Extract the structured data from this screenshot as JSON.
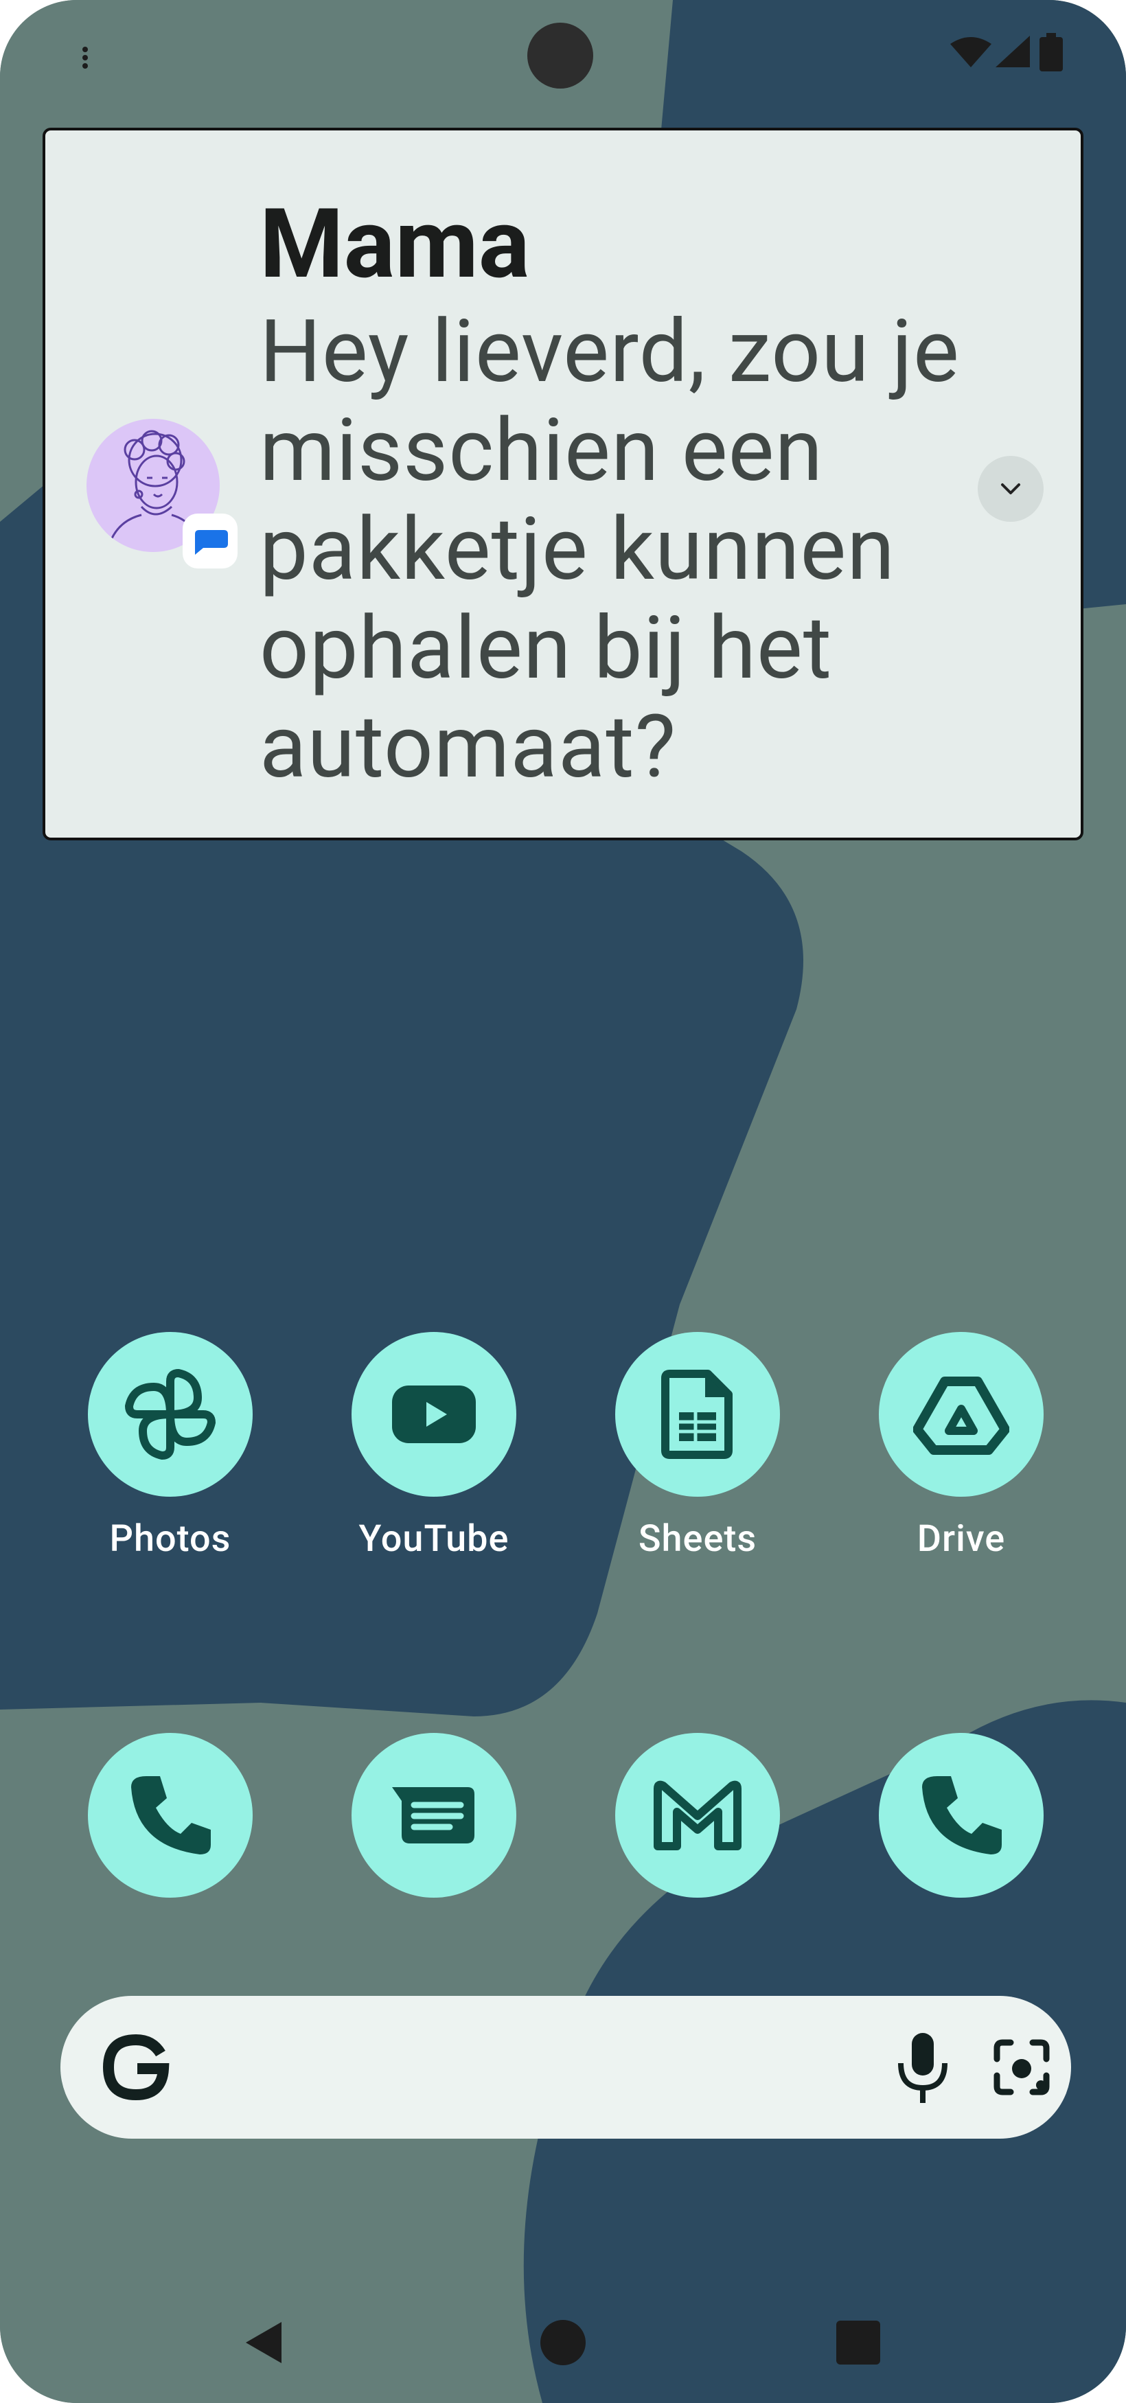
{
  "colors": {
    "wallpaper_light": "#647e79",
    "wallpaper_dark": "#2c4a60",
    "card_background": "#e6edeb",
    "app_icon_background": "#96f2e4",
    "app_icon_glyph": "#0f4f46",
    "search_bar": "#edf3f1"
  },
  "status_bar": {
    "icons": [
      "overflow-dots-icon",
      "wifi-icon",
      "signal-icon",
      "battery-icon"
    ]
  },
  "notification": {
    "app_icon": "messages-icon",
    "title": "Mama",
    "text": "Hey lieverd, zou je misschien een pakketje kunnen ophalen bij het automaat?",
    "expand_icon": "chevron-down-icon"
  },
  "apps": [
    {
      "label": "Photos",
      "icon": "pinwheel-icon"
    },
    {
      "label": "YouTube",
      "icon": "play-button-icon"
    },
    {
      "label": "Sheets",
      "icon": "spreadsheet-icon"
    },
    {
      "label": "Drive",
      "icon": "drive-triangle-icon"
    }
  ],
  "dock": [
    {
      "icon": "phone-icon"
    },
    {
      "icon": "messages-icon"
    },
    {
      "icon": "gmail-icon"
    },
    {
      "icon": "phone-icon"
    }
  ],
  "search_bar": {
    "icons": [
      "google-g-icon",
      "microphone-icon",
      "lens-camera-icon"
    ]
  },
  "nav_bar": {
    "icons": [
      "back-icon",
      "home-icon",
      "recents-icon"
    ]
  }
}
